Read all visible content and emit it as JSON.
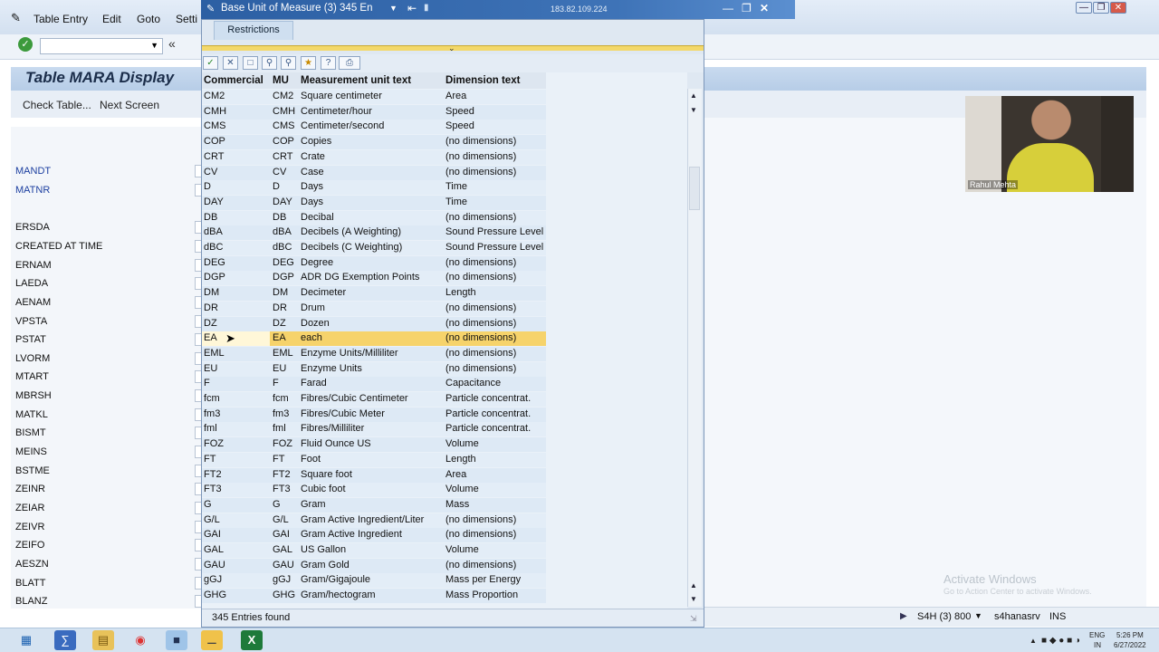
{
  "main_window": {
    "menu": [
      "Table Entry",
      "Edit",
      "Goto",
      "Setti"
    ],
    "title": "Table MARA Display",
    "toolbar_buttons": [
      "Check Table...",
      "Next Screen"
    ],
    "fields": [
      "MANDT",
      "MATNR",
      "ERSDA",
      "CREATED AT TIME",
      "ERNAM",
      "LAEDA",
      "AENAM",
      "VPSTA",
      "PSTAT",
      "LVORM",
      "MTART",
      "MBRSH",
      "MATKL",
      "BISMT",
      "MEINS",
      "BSTME",
      "ZEINR",
      "ZEIAR",
      "ZEIVR",
      "ZEIFO",
      "AESZN",
      "BLATT",
      "BLANZ"
    ]
  },
  "dialog": {
    "title": "Base Unit of Measure (3)  345 En",
    "ip": "183.82.109.224",
    "tab": "Restrictions",
    "columns": [
      "Commercial",
      "MU",
      "Measurement unit text",
      "Dimension text"
    ],
    "rows": [
      [
        "CM2",
        "CM2",
        "Square centimeter",
        "Area"
      ],
      [
        "CMH",
        "CMH",
        "Centimeter/hour",
        "Speed"
      ],
      [
        "CMS",
        "CMS",
        "Centimeter/second",
        "Speed"
      ],
      [
        "COP",
        "COP",
        "Copies",
        "(no dimensions)"
      ],
      [
        "CRT",
        "CRT",
        "Crate",
        "(no dimensions)"
      ],
      [
        "CV",
        "CV",
        "Case",
        "(no dimensions)"
      ],
      [
        "D",
        "D",
        "Days",
        "Time"
      ],
      [
        "DAY",
        "DAY",
        "Days",
        "Time"
      ],
      [
        "DB",
        "DB",
        "Decibal",
        "(no dimensions)"
      ],
      [
        "dBA",
        "dBA",
        "Decibels (A Weighting)",
        "Sound Pressure Level"
      ],
      [
        "dBC",
        "dBC",
        "Decibels (C Weighting)",
        "Sound Pressure Level"
      ],
      [
        "DEG",
        "DEG",
        "Degree",
        "(no dimensions)"
      ],
      [
        "DGP",
        "DGP",
        "ADR DG Exemption Points",
        "(no dimensions)"
      ],
      [
        "DM",
        "DM",
        "Decimeter",
        "Length"
      ],
      [
        "DR",
        "DR",
        "Drum",
        "(no dimensions)"
      ],
      [
        "DZ",
        "DZ",
        "Dozen",
        "(no dimensions)"
      ],
      [
        "EA",
        "EA",
        "each",
        "(no dimensions)"
      ],
      [
        "EML",
        "EML",
        "Enzyme Units/Milliliter",
        "(no dimensions)"
      ],
      [
        "EU",
        "EU",
        "Enzyme Units",
        "(no dimensions)"
      ],
      [
        "F",
        "F",
        "Farad",
        "Capacitance"
      ],
      [
        "fcm",
        "fcm",
        "Fibres/Cubic Centimeter",
        "Particle concentrat."
      ],
      [
        "fm3",
        "fm3",
        "Fibres/Cubic Meter",
        "Particle concentrat."
      ],
      [
        "fml",
        "fml",
        "Fibres/Milliliter",
        "Particle concentrat."
      ],
      [
        "FOZ",
        "FOZ",
        "Fluid Ounce US",
        "Volume"
      ],
      [
        "FT",
        "FT",
        "Foot",
        "Length"
      ],
      [
        "FT2",
        "FT2",
        "Square foot",
        "Area"
      ],
      [
        "FT3",
        "FT3",
        "Cubic foot",
        "Volume"
      ],
      [
        "G",
        "G",
        "Gram",
        "Mass"
      ],
      [
        "G/L",
        "G/L",
        "Gram Active Ingredient/Liter",
        "(no dimensions)"
      ],
      [
        "GAI",
        "GAI",
        "Gram Active Ingredient",
        "(no dimensions)"
      ],
      [
        "GAL",
        "GAL",
        "US Gallon",
        "Volume"
      ],
      [
        "GAU",
        "GAU",
        "Gram Gold",
        "(no dimensions)"
      ],
      [
        "gGJ",
        "gGJ",
        "Gram/Gigajoule",
        "Mass per Energy"
      ],
      [
        "GHG",
        "GHG",
        "Gram/hectogram",
        "Mass Proportion"
      ]
    ],
    "selected_row": 16,
    "status": "345 Entries found"
  },
  "video": {
    "name": "Rahul Mehta"
  },
  "watermark": {
    "line1": "Activate Windows",
    "line2": "Go to Action Center to activate Windows."
  },
  "statusbar": {
    "system": "S4H (3) 800",
    "server": "s4hanasrv",
    "mode": "INS"
  },
  "taskbar": {
    "lang1": "ENG",
    "lang2": "IN",
    "time": "5:26 PM",
    "date": "6/27/2022"
  }
}
